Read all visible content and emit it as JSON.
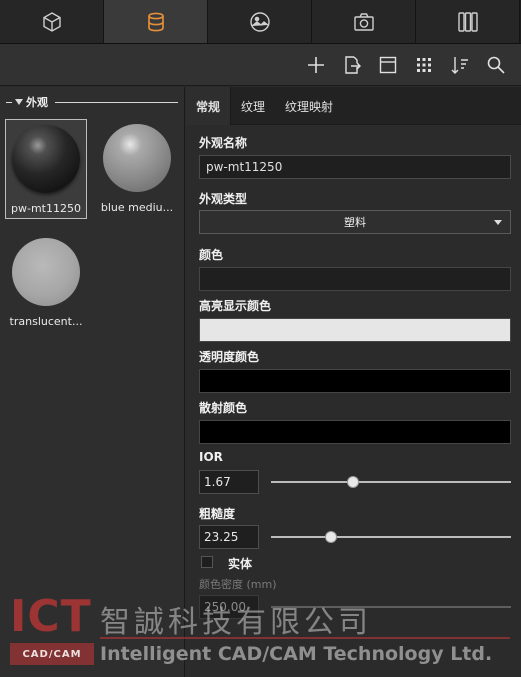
{
  "top_tabs": [
    {
      "icon": "cube-icon"
    },
    {
      "icon": "database-icon",
      "active": true
    },
    {
      "icon": "image-icon"
    },
    {
      "icon": "camera-icon"
    },
    {
      "icon": "columns-icon"
    }
  ],
  "toolbar": [
    {
      "icon": "add-icon"
    },
    {
      "icon": "export-icon"
    },
    {
      "icon": "panel-icon"
    },
    {
      "icon": "grid-view-icon"
    },
    {
      "icon": "sort-icon"
    },
    {
      "icon": "search-icon"
    }
  ],
  "library": {
    "group_label": "外观",
    "items": [
      {
        "name": "pw-mt11250",
        "selected": true
      },
      {
        "name": "blue mediu..."
      },
      {
        "name": "translucent..."
      }
    ]
  },
  "subtabs": [
    "常规",
    "纹理",
    "纹理映射"
  ],
  "form": {
    "appearance_name_label": "外观名称",
    "appearance_name_value": "pw-mt11250",
    "appearance_type_label": "外观类型",
    "appearance_type_value": "塑料",
    "color_label": "颜色",
    "highlight_color_label": "高亮显示颜色",
    "transparency_color_label": "透明度颜色",
    "scatter_color_label": "散射颜色",
    "ior_label": "IOR",
    "ior_value": "1.67",
    "roughness_label": "粗糙度",
    "roughness_value": "23.25",
    "solid_label": "实体",
    "color_density_label": "颜色密度 (mm)",
    "color_density_value": "250.00"
  },
  "sliders": {
    "ior_fraction": 0.34,
    "roughness_fraction": 0.25
  },
  "colors": {
    "color_swatch": "#1f1f1f",
    "highlight_swatch": "#e6e6e6",
    "transparency_swatch": "#000000",
    "scatter_swatch": "#000000"
  },
  "watermark": {
    "logo_text": "ICT",
    "logo_sub": "CAD/CAM",
    "chinese_name": "智誠科技有限公司",
    "english_name": "Intelligent CAD/CAM Technology Ltd."
  }
}
